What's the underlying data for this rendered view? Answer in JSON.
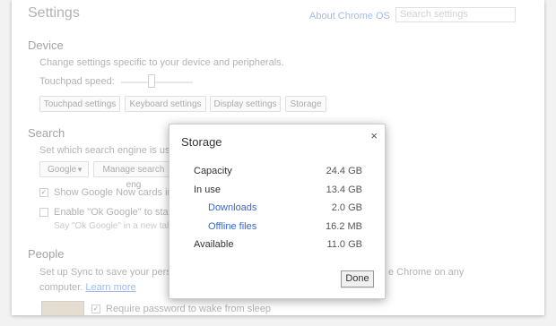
{
  "settings": {
    "title": "Settings",
    "about_link": "About Chrome OS",
    "search_placeholder": "Search settings",
    "device": {
      "heading": "Device",
      "desc": "Change settings specific to your device and peripherals.",
      "touchpad_label": "Touchpad speed:",
      "buttons": [
        "Touchpad settings",
        "Keyboard settings",
        "Display settings",
        "Storage"
      ]
    },
    "search": {
      "heading": "Search",
      "desc": "Set which search engine is used wh",
      "engine_select": "Google",
      "manage_button": "Manage search eng",
      "google_now": "Show Google Now cards in the",
      "ok_google": "Enable \"Ok Google\" to start a vo",
      "ok_google_hint": "Say \"Ok Google\" in a new tab, go"
    },
    "people": {
      "heading": "People",
      "desc_left": "Set up Sync to save your personaliz",
      "desc_right": "e Chrome on any",
      "desc_line2": "computer.",
      "learn_more": "Learn more",
      "require_password": "Require password to wake from sleep"
    }
  },
  "dialog": {
    "title": "Storage",
    "close_glyph": "×",
    "rows": [
      {
        "label": "Capacity",
        "value": "24.4 GB"
      },
      {
        "label": "In use",
        "value": "13.4 GB"
      },
      {
        "label": "Downloads",
        "value": "2.0 GB"
      },
      {
        "label": "Offline files",
        "value": "16.2 MB"
      },
      {
        "label": "Available",
        "value": "11.0 GB"
      }
    ],
    "done_label": "Done"
  },
  "colors": {
    "link": "#3367d6",
    "background": "#f2f2f2"
  }
}
